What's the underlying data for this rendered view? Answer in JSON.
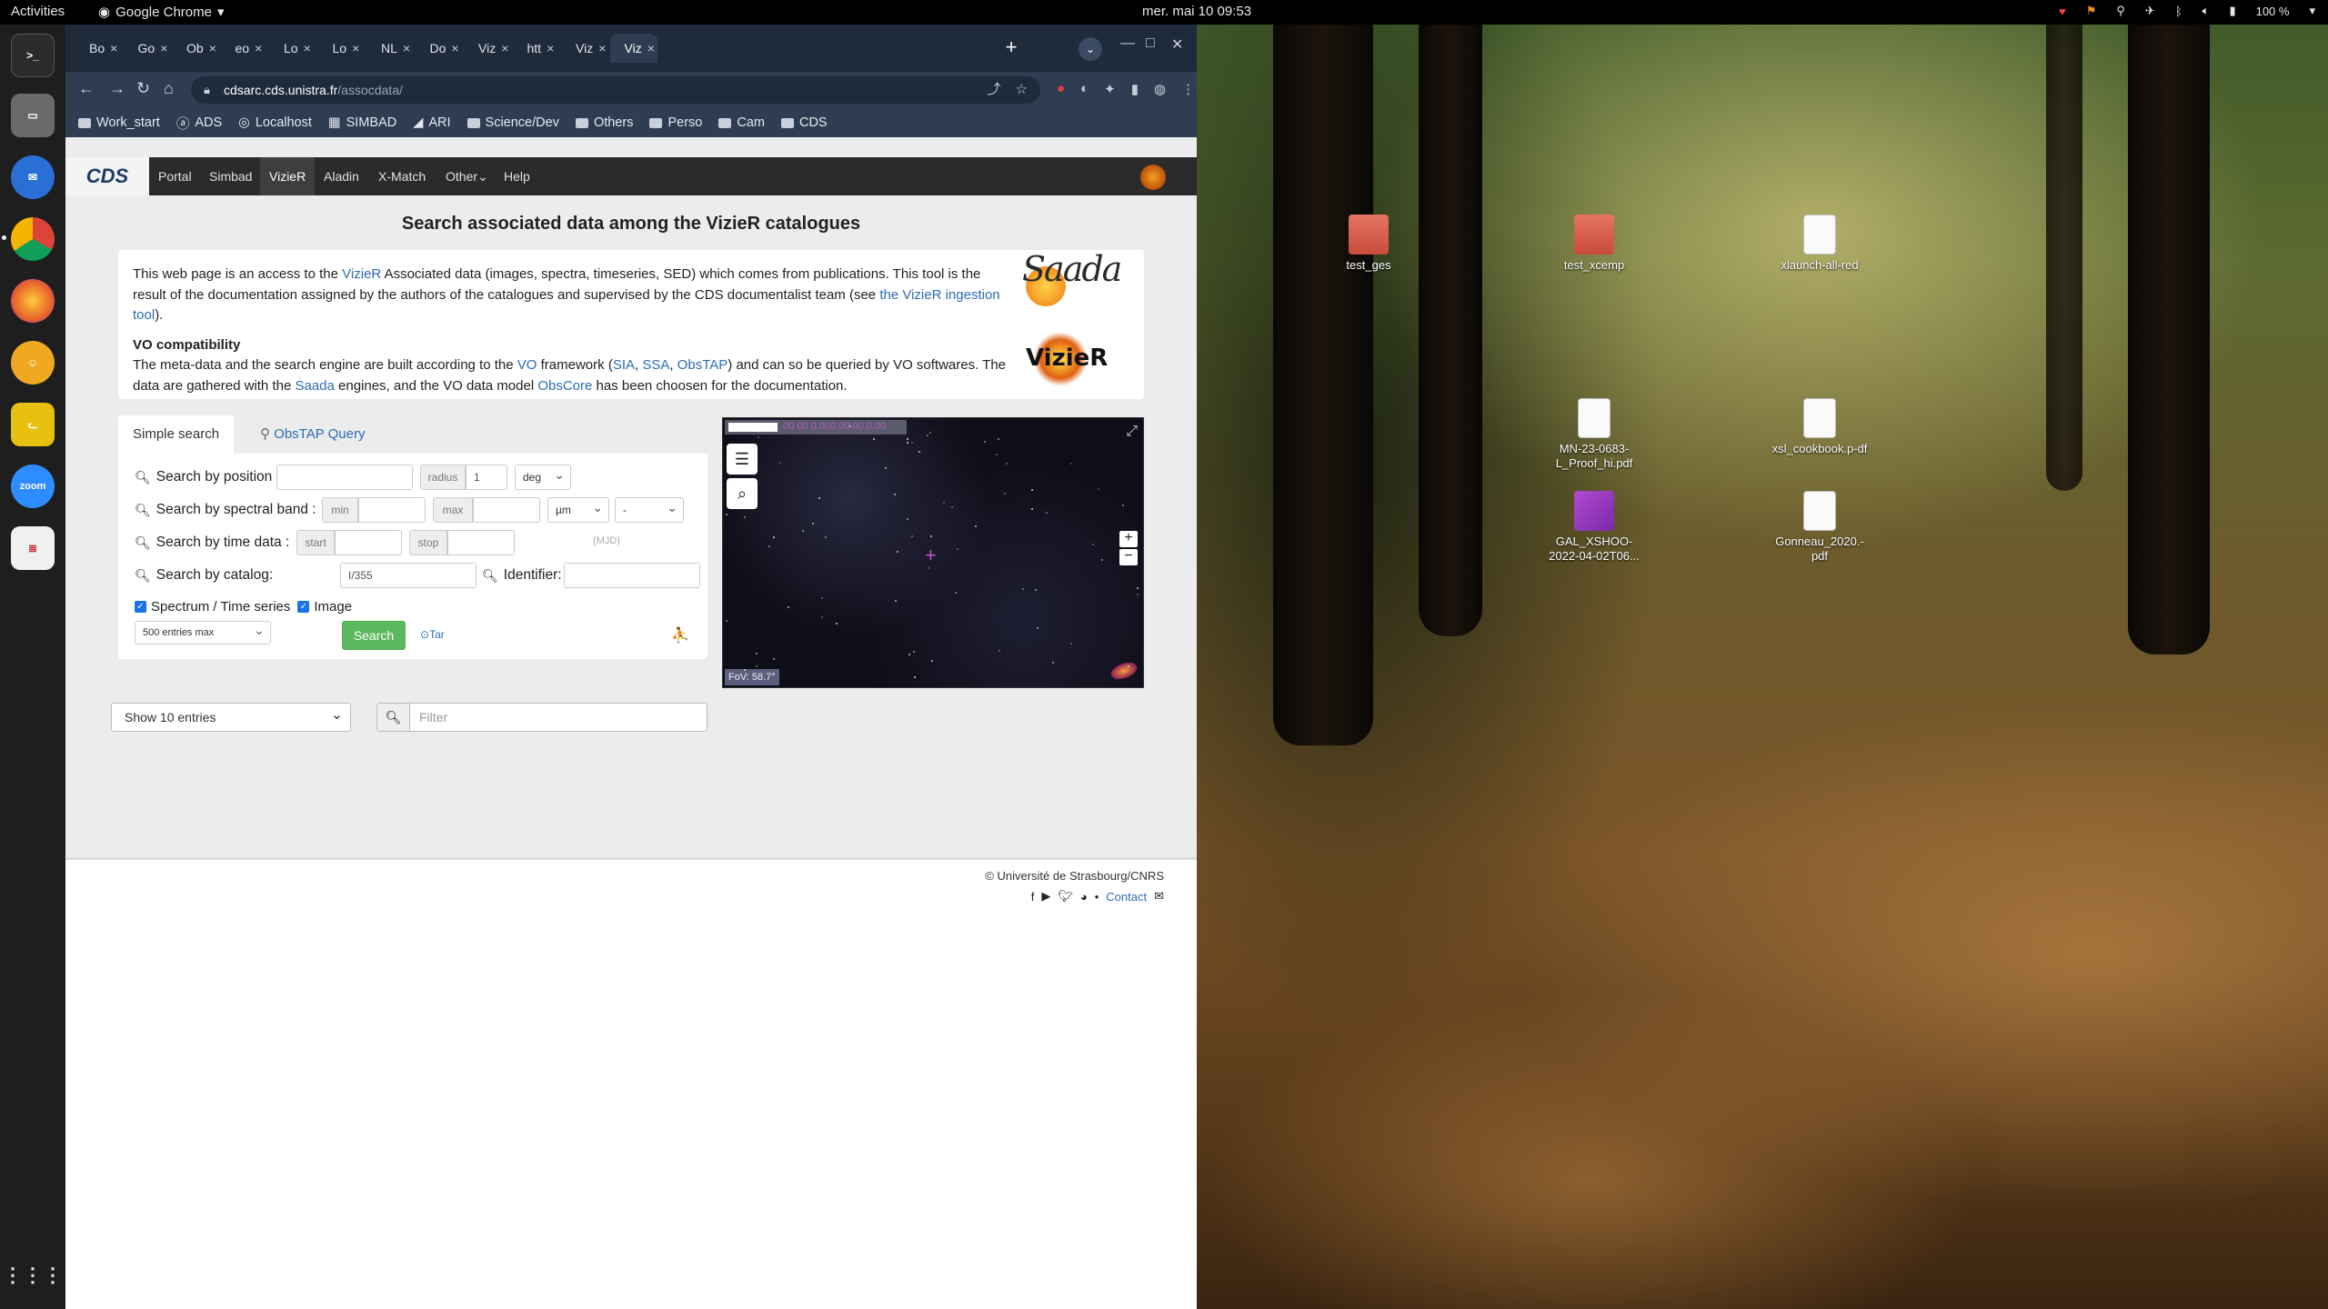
{
  "topbar": {
    "activities": "Activities",
    "app_name": "Google Chrome",
    "clock": "mer. mai 10  09:53",
    "battery": "100 %"
  },
  "dock": {
    "items": [
      {
        "name": "terminal-icon",
        "color": "#2b2b2b"
      },
      {
        "name": "files-icon",
        "color": "#5a5a5a"
      },
      {
        "name": "thunderbird-icon",
        "color": "#2a6fd6"
      },
      {
        "name": "chrome-icon",
        "color": "#e8e8e8"
      },
      {
        "name": "firefox-icon",
        "color": "#e8642a"
      },
      {
        "name": "app-yellow-icon",
        "color": "#f0c020"
      },
      {
        "name": "cat-app-icon",
        "color": "#e8c010"
      },
      {
        "name": "zoom-icon",
        "color": "#2d8cff",
        "label": "zoom"
      },
      {
        "name": "document-viewer-icon",
        "color": "#f0f0f0"
      }
    ]
  },
  "desktop": {
    "icons": [
      {
        "label": "test_ges",
        "type": "folder"
      },
      {
        "label": "test_xcemp",
        "type": "folder"
      },
      {
        "label": "xlaunch-all-red",
        "type": "doc"
      },
      {
        "label": "MN-23-0683-L_Proof_hi.pdf",
        "type": "doc"
      },
      {
        "label": "xsl_cookbook.p-df",
        "type": "doc"
      },
      {
        "label": "GAL_XSHOO-2022-04-02T06...",
        "type": "image"
      },
      {
        "label": "Gonneau_2020.-pdf",
        "type": "doc"
      }
    ]
  },
  "browser": {
    "tabs": [
      {
        "label": "Bo",
        "fav_color": "#d44638"
      },
      {
        "label": "Go",
        "fav_color": "#f4b400"
      },
      {
        "label": "Ob",
        "fav_color": "#d83a3a"
      },
      {
        "label": "eo",
        "fav_color": "#f4b400"
      },
      {
        "label": "Lo",
        "fav_color": "#4a8ef0"
      },
      {
        "label": "Lo",
        "fav_color": "#4a8ef0"
      },
      {
        "label": "NL",
        "fav_color": "#ffffff"
      },
      {
        "label": "Do",
        "fav_color": "#4a8ef0"
      },
      {
        "label": "Viz",
        "fav_color": "#e06010"
      },
      {
        "label": "htt",
        "fav_color": "#d83a3a"
      },
      {
        "label": "Viz",
        "fav_color": "#e06010"
      },
      {
        "label": "Viz",
        "fav_color": "#e06010"
      }
    ],
    "url_host": "cdsarc.cds.unistra.fr",
    "url_path": "/assocdata/",
    "bookmarks": [
      "Work_start",
      "ADS",
      "Localhost",
      "SIMBAD",
      "ARI",
      "Science/Dev",
      "Others",
      "Perso",
      "Cam",
      "CDS"
    ]
  },
  "cds_nav": {
    "logo": "CDS",
    "items": [
      "Portal",
      "Simbad",
      "VizieR",
      "Aladin",
      "X-Match",
      "Other",
      "Help"
    ]
  },
  "page": {
    "title": "Search associated data among the VizieR catalogues",
    "intro": {
      "t1": "This web page is an access to the ",
      "vizier_link": "VizieR",
      "t2": " Associated data (images, spectra, timeseries, SED) which comes from publications. This tool is the result of the documentation assigned by the authors of the catalogues and supervised by the CDS documentalist team (see ",
      "ingestion_link": "the VizieR ingestion tool",
      "t3": ").",
      "vo_title": "VO compatibility",
      "v1": "The meta-data and the search engine are built according to the ",
      "vo_link": "VO",
      "v2": " framework (",
      "sia_link": "SIA",
      "comma1": ", ",
      "ssa_link": "SSA",
      "comma2": ", ",
      "obstap_link": "ObsTAP",
      "v3": ") and can so be queried by VO softwares. The data are gathered with the ",
      "saada_link": "Saada",
      "v4": " engines, and the VO data model ",
      "obscore_link": "ObsCore",
      "v5": " has been choosen for the documentation.",
      "saada_logo": "Saada",
      "vizier_logo": "VizieR"
    },
    "search": {
      "tab_simple": "Simple search",
      "tab_obstap": "ObsTAP Query",
      "position_label": "Search by position :",
      "radius_label": "radius",
      "radius_value": "1",
      "radius_unit": "deg",
      "spectral_label": "Search by spectral band :",
      "min_label": "min",
      "max_label": "max",
      "spectral_unit": "µm",
      "spectral_extra": "-",
      "time_label": "Search by time data :",
      "start_label": "start",
      "stop_label": "stop",
      "mjd_label": "(MJD)",
      "catalog_label": "Search by catalog:",
      "catalog_value": "I/355",
      "identifier_label": "Identifier:",
      "spectrum_label": "Spectrum / Time series",
      "image_label": "Image",
      "max_entries": "500 entries max",
      "search_button": "Search",
      "tar_label": "Tar"
    },
    "aladin": {
      "coords": "00 00 0.000 00 00 0.00",
      "fov": "FoV: 58.7°",
      "zoom_in": "+",
      "zoom_out": "−"
    },
    "table": {
      "entries_select": "Show 10 entries",
      "filter_placeholder": "Filter"
    },
    "footer": {
      "copyright": "© Université de Strasbourg/CNRS",
      "contact": "Contact"
    }
  }
}
